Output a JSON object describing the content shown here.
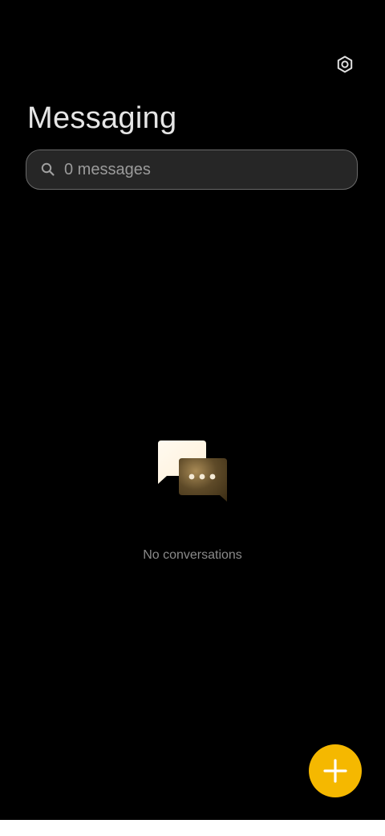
{
  "header": {
    "title": "Messaging",
    "settings_icon": "gear-icon"
  },
  "search": {
    "placeholder": "0 messages",
    "icon": "search-icon"
  },
  "empty_state": {
    "illustration": "chat-bubbles-icon",
    "message": "No conversations"
  },
  "fab": {
    "icon": "plus-icon",
    "color": "#f5b800"
  },
  "colors": {
    "background": "#000000",
    "accent": "#f5b800",
    "title_text": "#e6e6e6",
    "secondary_text": "#8a8a8a"
  }
}
